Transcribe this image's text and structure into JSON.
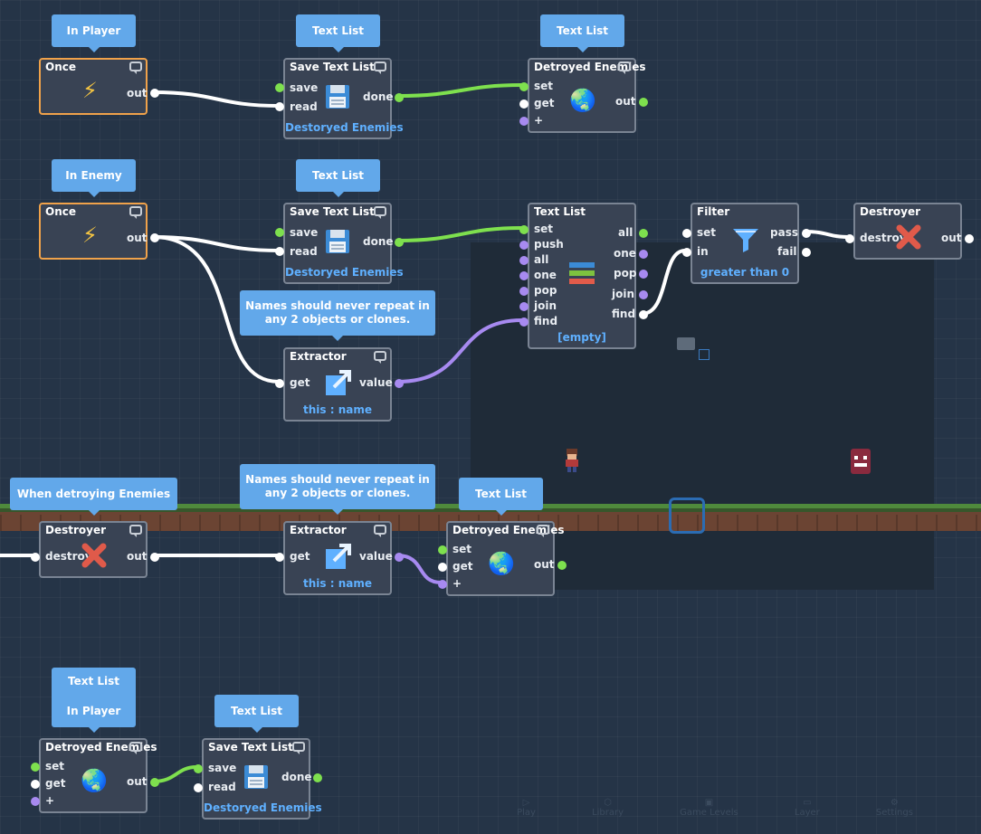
{
  "tips": {
    "t1": "In Player",
    "t2": "Text List",
    "t3": "Text List",
    "t4": "In Enemy",
    "t5": "Text List",
    "t6": "Names should never repeat in any 2 objects or clones.",
    "t7": "When detroying Enemies",
    "t8": "Names should never repeat in any 2 objects or clones.",
    "t9": "Text List",
    "t10a": "Text List",
    "t10b": "In Player",
    "t11": "Text List"
  },
  "nodes": {
    "once1": {
      "title": "Once",
      "out": "out"
    },
    "save1": {
      "title": "Save Text List",
      "save": "save",
      "read": "read",
      "done": "done",
      "sub": "Destoryed Enemies"
    },
    "var1": {
      "title": "Detroyed Enemies",
      "set": "set",
      "get": "get",
      "plus": "+",
      "out": "out"
    },
    "once2": {
      "title": "Once",
      "out": "out"
    },
    "save2": {
      "title": "Save Text List",
      "save": "save",
      "read": "read",
      "done": "done",
      "sub": "Destoryed Enemies"
    },
    "tlist": {
      "title": "Text List",
      "set": "set",
      "push": "push",
      "all": "all",
      "one": "one",
      "pop": "pop",
      "join": "join",
      "find": "find",
      "o_all": "all",
      "o_one": "one",
      "o_pop": "pop",
      "o_join": "join",
      "o_find": "find",
      "sub": "[empty]"
    },
    "filter": {
      "title": "Filter",
      "set": "set",
      "in": "in",
      "pass": "pass",
      "fail": "fail",
      "sub": "greater than 0"
    },
    "destroyer1": {
      "title": "Destroyer",
      "destroy": "destroy",
      "out": "out"
    },
    "extract1": {
      "title": "Extractor",
      "get": "get",
      "value": "value",
      "sub": "this : name"
    },
    "destroyer2": {
      "title": "Destroyer",
      "destroy": "destroy",
      "out": "out"
    },
    "extract2": {
      "title": "Extractor",
      "get": "get",
      "value": "value",
      "sub": "this : name"
    },
    "var2": {
      "title": "Detroyed Enemies",
      "set": "set",
      "get": "get",
      "plus": "+",
      "out": "out"
    },
    "var3": {
      "title": "Detroyed Enemies",
      "set": "set",
      "get": "get",
      "plus": "+",
      "out": "out"
    },
    "save3": {
      "title": "Save Text List",
      "save": "save",
      "read": "read",
      "done": "done",
      "sub": "Destoryed Enemies"
    }
  },
  "icons": {
    "once": "lightning-icon",
    "save": "floppy-disk-icon",
    "variable": "globe-icon",
    "text_list": "list-icon",
    "filter": "funnel-icon",
    "destroyer": "red-x-icon",
    "extractor": "export-arrow-icon"
  },
  "toolbar": {
    "play": "Play",
    "library": "Library",
    "levels": "Game Levels",
    "layer": "Layer",
    "settings": "Settings"
  },
  "colors": {
    "background": "#253447",
    "node": "#394354",
    "trigger_border": "#f0a24a",
    "tip": "#62a8ea",
    "wire_bool": "#7ee04e",
    "wire_text": "#a78af0",
    "wire_flow": "#ffffff",
    "subtitle": "#5fb0ff"
  }
}
